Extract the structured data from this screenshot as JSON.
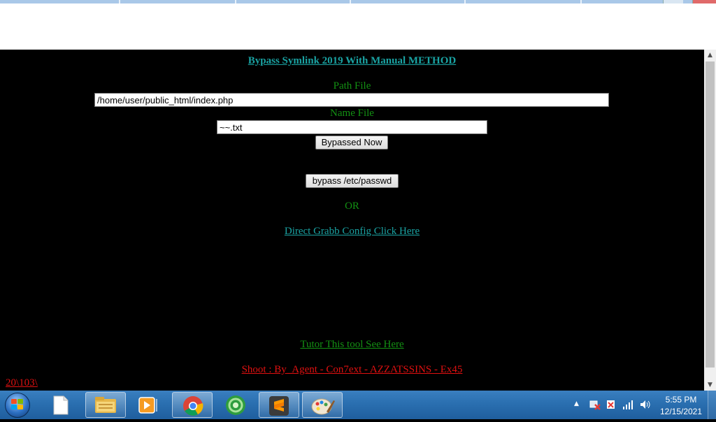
{
  "page": {
    "title_link": "Bypass Symlink 2019 With Manual METHOD",
    "path_file_label": "Path File",
    "path_file_value": "/home/user/public_html/index.php",
    "name_file_label": "Name File",
    "name_file_value": "~~.txt",
    "bypassed_button": "Bypassed Now",
    "bypass_passwd_button": "bypass /etc/passwd",
    "or_text": "OR",
    "direct_grab_link": "Direct Grabb Config Click Here",
    "tutor_link": "Tutor This tool See Here",
    "shoot_link": "Shoot : By_Agent - Con7ext - AZZATSSINS - Ex45",
    "path_link": "20\\103\\"
  },
  "colors": {
    "background": "#000000",
    "teal_link": "#1aa3a3",
    "green_text": "#139113",
    "red_link": "#e01010"
  },
  "scrollbar": {
    "up_arrow": "▲",
    "down_arrow": "▼"
  },
  "taskbar": {
    "apps": [
      {
        "name": "windows-start-icon"
      },
      {
        "name": "blank-document-icon"
      },
      {
        "name": "file-explorer-icon"
      },
      {
        "name": "media-player-icon"
      },
      {
        "name": "chrome-icon"
      },
      {
        "name": "green-globe-icon"
      },
      {
        "name": "sublime-text-icon"
      },
      {
        "name": "paint-icon"
      }
    ],
    "tray": {
      "show_hidden": "▲",
      "time": "5:55 PM",
      "date": "12/15/2021"
    }
  }
}
